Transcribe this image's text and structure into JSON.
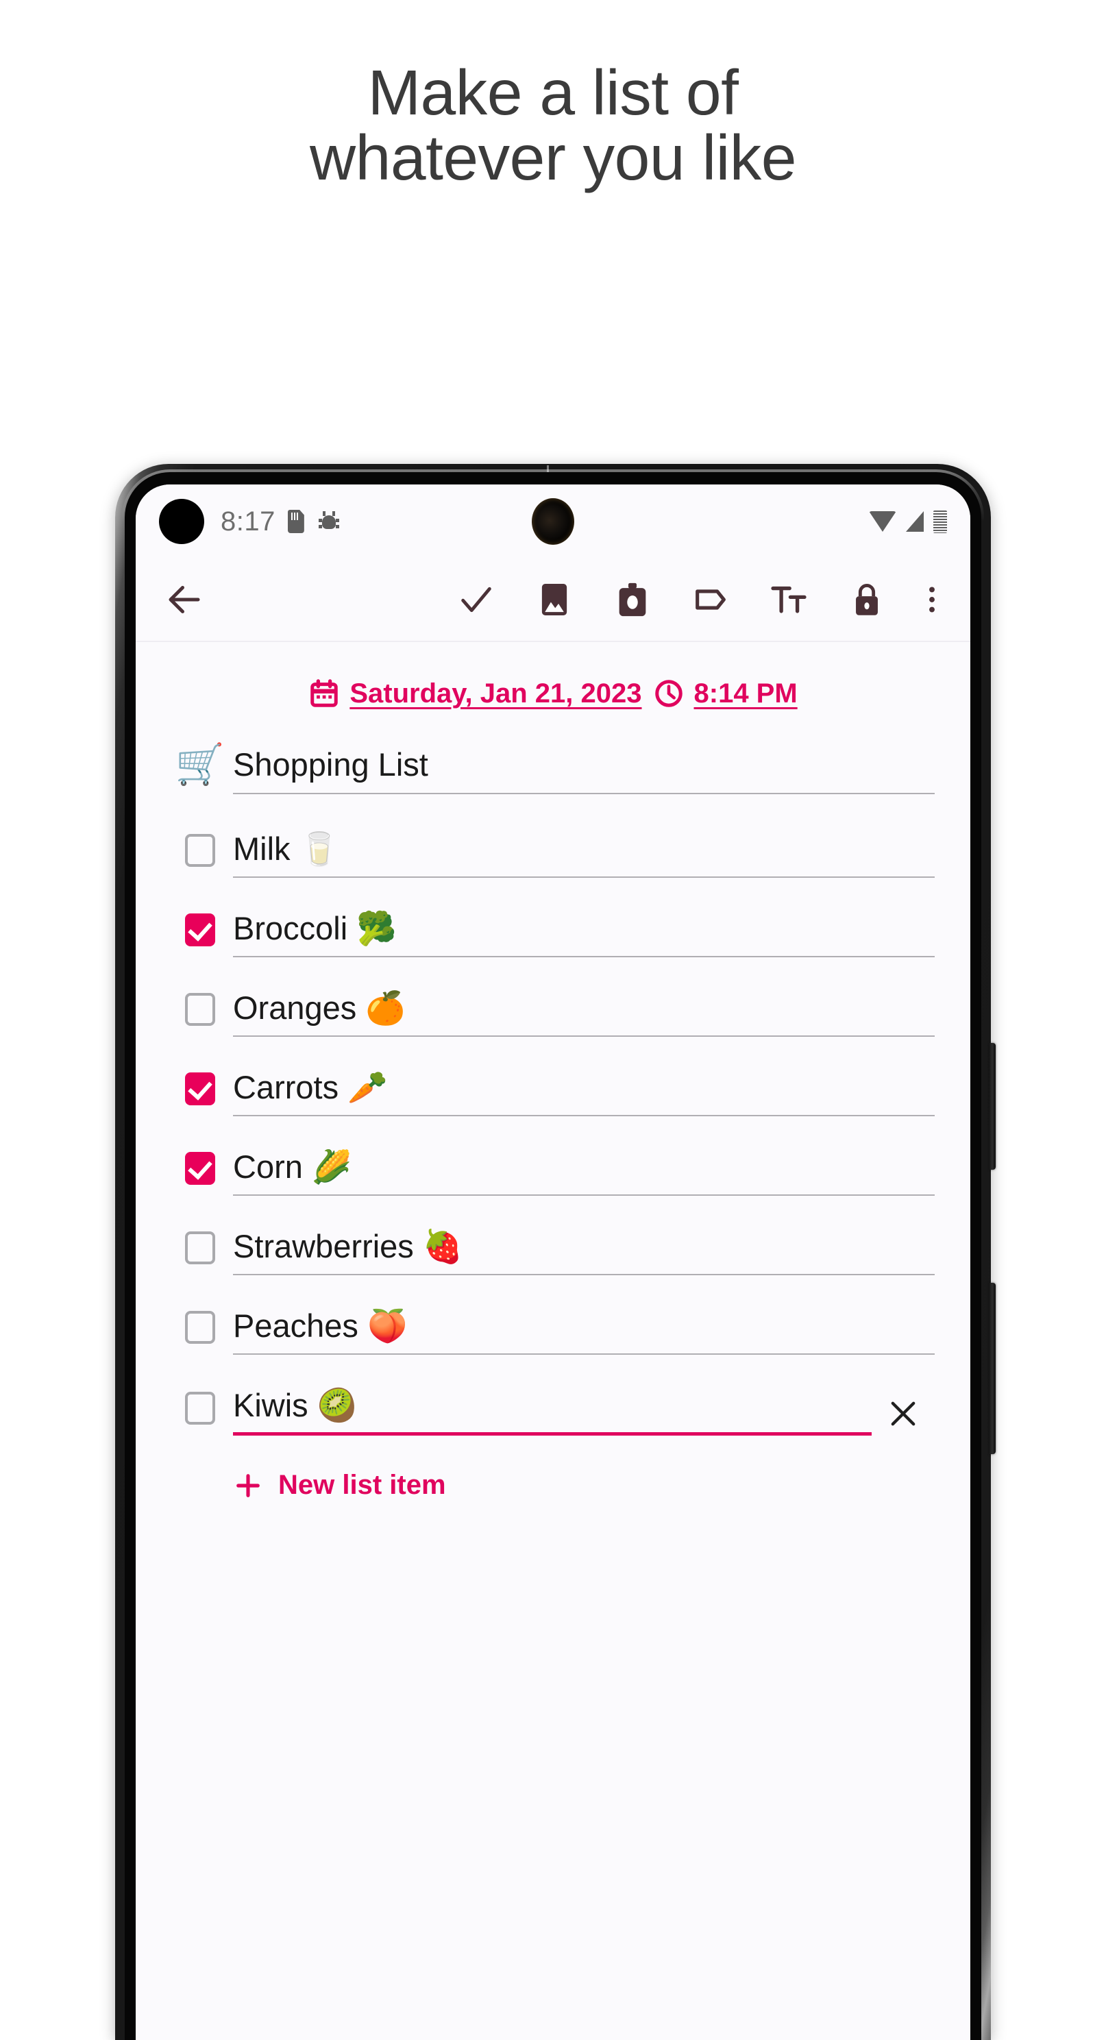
{
  "headline": {
    "line1": "Make a list of",
    "line2": "whatever you like"
  },
  "colors": {
    "accent_pink": "#e0045e",
    "checkbox_pink": "#e8005a",
    "toolbar_icon": "#4a3137",
    "screen_bg": "#fbfafd",
    "headline_text": "#3b3b3b",
    "divider": "#b0aeb3"
  },
  "phone": {
    "status_bar": {
      "time": "8:17",
      "left_icons": [
        "sd-card-icon",
        "android-bug-icon"
      ],
      "right_icons": [
        "wifi-icon",
        "cellular-signal-icon",
        "battery-icon"
      ],
      "punch_hole": "front-camera-punch-hole"
    },
    "toolbar": {
      "back_label": "back-arrow-icon",
      "items": [
        {
          "name": "checkmark-icon",
          "label": "Done"
        },
        {
          "name": "image-icon",
          "label": "Insert image"
        },
        {
          "name": "camera-icon",
          "label": "Take photo"
        },
        {
          "name": "tag-icon",
          "label": "Labels"
        },
        {
          "name": "text-format-icon",
          "label": "Text formatting"
        },
        {
          "name": "lock-icon",
          "label": "Lock note"
        },
        {
          "name": "overflow-menu-icon",
          "label": "More options"
        }
      ]
    },
    "note": {
      "date": {
        "icon": "calendar-icon",
        "text": "Saturday, Jan 21, 2023"
      },
      "time": {
        "icon": "clock-icon",
        "text": "8:14 PM"
      },
      "title": {
        "emoji": "🛒",
        "text": "Shopping List"
      },
      "items": [
        {
          "text": "Milk 🥛",
          "checked": false,
          "active": false
        },
        {
          "text": "Broccoli 🥦",
          "checked": true,
          "active": false
        },
        {
          "text": "Oranges 🍊",
          "checked": false,
          "active": false
        },
        {
          "text": "Carrots 🥕",
          "checked": true,
          "active": false
        },
        {
          "text": "Corn 🌽",
          "checked": true,
          "active": false
        },
        {
          "text": "Strawberries 🍓",
          "checked": false,
          "active": false
        },
        {
          "text": "Peaches 🍑",
          "checked": false,
          "active": false
        },
        {
          "text": "Kiwis 🥝",
          "checked": false,
          "active": true
        }
      ],
      "delete_icon": "close-x-icon",
      "new_item": {
        "icon": "plus-icon",
        "label": "New list item"
      }
    }
  }
}
